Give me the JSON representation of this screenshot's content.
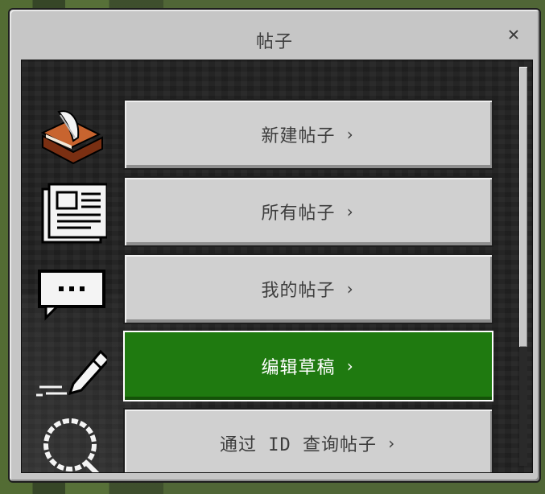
{
  "dialog": {
    "title": "帖子",
    "close_label": "✕"
  },
  "menu": {
    "items": [
      {
        "label": "新建帖子",
        "chevron": "›",
        "icon": "book-quill-icon",
        "active": false
      },
      {
        "label": "所有帖子",
        "chevron": "›",
        "icon": "newspaper-icon",
        "active": false
      },
      {
        "label": "我的帖子",
        "chevron": "›",
        "icon": "chat-bubble-icon",
        "active": false
      },
      {
        "label": "编辑草稿",
        "chevron": "›",
        "icon": "pencil-icon",
        "active": true
      },
      {
        "label": "通过 ID 查询帖子",
        "chevron": "›",
        "icon": "magnifier-icon",
        "active": false
      }
    ]
  },
  "colors": {
    "panel": "#c6c6c6",
    "button": "#d0d0d0",
    "active_button": "#1f7a10",
    "content_bg": "#232323"
  }
}
